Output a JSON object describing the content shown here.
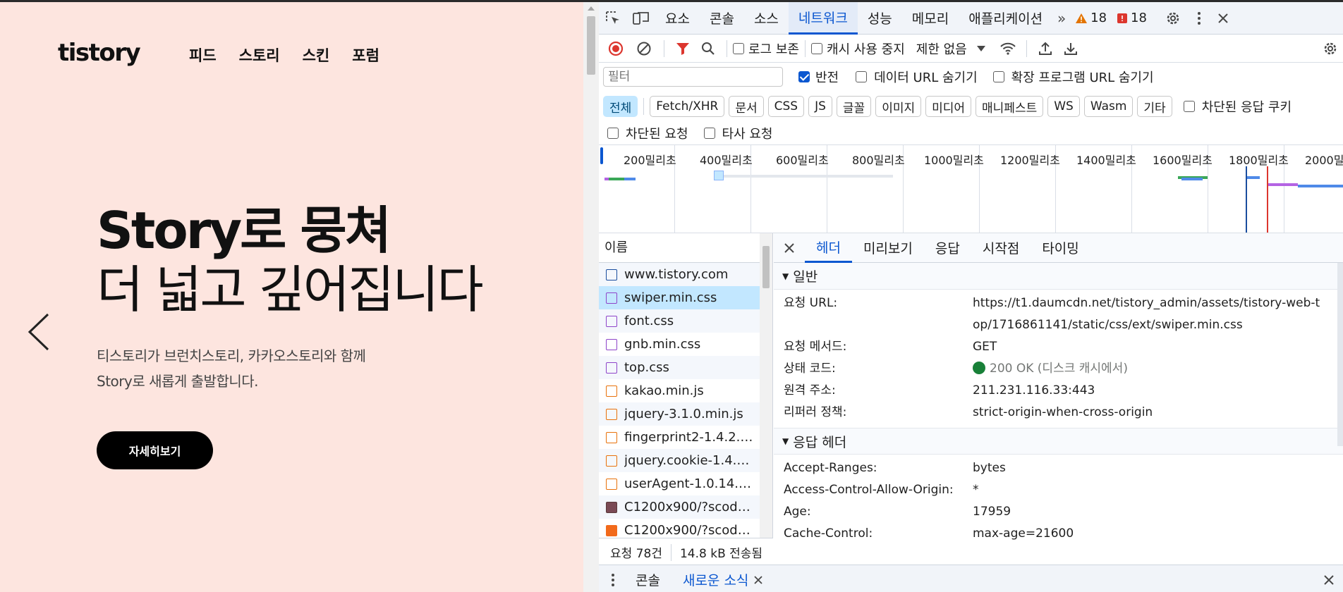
{
  "site": {
    "logo": "tistory",
    "nav": [
      "피드",
      "스토리",
      "스킨",
      "포럼"
    ],
    "headline_1": "Story로 뭉쳐",
    "headline_2": "더 넓고 깊어집니다",
    "desc_1": "티스토리가 브런치스토리, 카카오스토리와 함께",
    "desc_2": "Story로 새롭게 출발합니다.",
    "more_button": "자세히보기"
  },
  "devtools": {
    "tabs": [
      "요소",
      "콘솔",
      "소스",
      "네트워크",
      "성능",
      "메모리",
      "애플리케이션"
    ],
    "active_tab": "네트워크",
    "warnings": "18",
    "errors": "18",
    "toolbar": {
      "preserve_log": "로그 보존",
      "disable_cache": "캐시 사용 중지",
      "throttle": "제한 없음"
    },
    "filter": {
      "placeholder": "필터",
      "invert": "반전",
      "hide_data_urls": "데이터 URL 숨기기",
      "hide_ext_urls": "확장 프로그램 URL 숨기기"
    },
    "chips": [
      "전체",
      "Fetch/XHR",
      "문서",
      "CSS",
      "JS",
      "글꼴",
      "이미지",
      "미디어",
      "매니페스트",
      "WS",
      "Wasm",
      "기타"
    ],
    "blocked_cookies": "차단된 응답 쿠키",
    "blocked_requests": "차단된 요청",
    "third_party": "타사 요청",
    "timeline_labels": [
      "200밀리초",
      "400밀리초",
      "600밀리초",
      "800밀리초",
      "1000밀리초",
      "1200밀리초",
      "1400밀리초",
      "1600밀리초",
      "1800밀리초",
      "2000밀리초"
    ],
    "list_header": "이름",
    "requests": [
      {
        "name": "www.tistory.com",
        "type": "doc"
      },
      {
        "name": "swiper.min.css",
        "type": "css"
      },
      {
        "name": "font.css",
        "type": "css"
      },
      {
        "name": "gnb.min.css",
        "type": "css"
      },
      {
        "name": "top.css",
        "type": "css"
      },
      {
        "name": "kakao.min.js",
        "type": "js"
      },
      {
        "name": "jquery-3.1.0.min.js",
        "type": "js"
      },
      {
        "name": "fingerprint2-1.4.2.mi...",
        "type": "js"
      },
      {
        "name": "jquery.cookie-1.4.0....",
        "type": "js"
      },
      {
        "name": "userAgent-1.0.14.mi...",
        "type": "js"
      },
      {
        "name": "C1200x900/?scode=...",
        "type": "img"
      },
      {
        "name": "C1200x900/?scode=...",
        "type": "img2"
      }
    ],
    "status": {
      "requests": "요청 78건",
      "transferred": "14.8 kB 전송됨"
    },
    "detail_tabs": [
      "헤더",
      "미리보기",
      "응답",
      "시작점",
      "타이밍"
    ],
    "general": {
      "title": "일반",
      "rows": [
        {
          "k": "요청 URL:",
          "v": "https://t1.daumcdn.net/tistory_admin/assets/tistory-web-top/1716861141/static/css/ext/swiper.min.css"
        },
        {
          "k": "요청 메서드:",
          "v": "GET"
        },
        {
          "k": "상태 코드:",
          "v": "200 OK",
          "note": "(디스크 캐시에서)"
        },
        {
          "k": "원격 주소:",
          "v": "211.231.116.33:443"
        },
        {
          "k": "리퍼러 정책:",
          "v": "strict-origin-when-cross-origin"
        }
      ]
    },
    "response_headers": {
      "title": "응답 헤더",
      "rows": [
        {
          "k": "Accept-Ranges:",
          "v": "bytes"
        },
        {
          "k": "Access-Control-Allow-Origin:",
          "v": "*"
        },
        {
          "k": "Age:",
          "v": "17959"
        },
        {
          "k": "Cache-Control:",
          "v": "max-age=21600"
        }
      ]
    },
    "drawer": {
      "console": "콘솔",
      "whats_new": "새로운 소식"
    }
  }
}
